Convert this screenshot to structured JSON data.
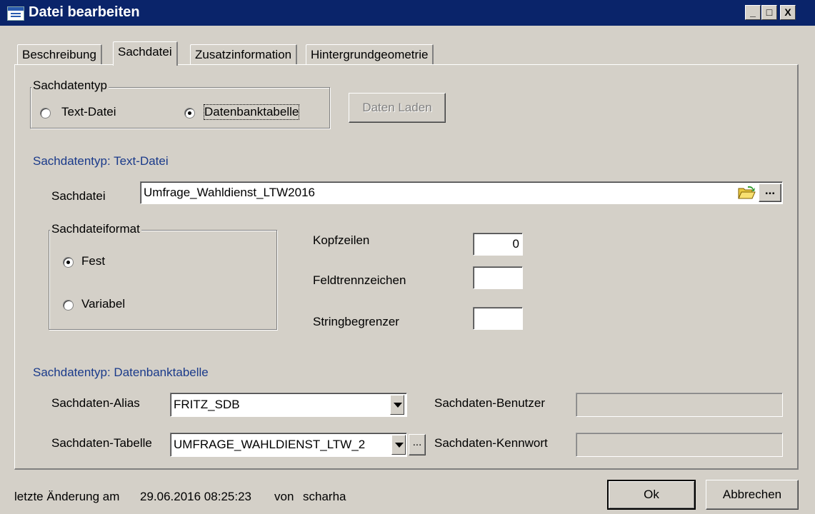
{
  "window": {
    "title": "Datei bearbeiten",
    "minimize": "_",
    "maximize": "□",
    "close": "X"
  },
  "tabs": [
    "Beschreibung",
    "Sachdatei",
    "Zusatzinformation",
    "Hintergrundgeometrie"
  ],
  "active_tab": "Sachdatei",
  "sachdatentyp": {
    "legend": "Sachdatentyp",
    "options": [
      "Text-Datei",
      "Datenbanktabelle"
    ],
    "selected": "Datenbanktabelle"
  },
  "daten_laden": "Daten Laden",
  "text_section": {
    "heading": "Sachdatentyp: Text-Datei",
    "sachdatei_label": "Sachdatei",
    "sachdatei_value": "Umfrage_Wahldienst_LTW2016",
    "browse_label": "...",
    "format": {
      "legend": "Sachdateiformat",
      "options": [
        "Fest",
        "Variabel"
      ],
      "selected": "Fest"
    },
    "kopfzeilen_label": "Kopfzeilen",
    "kopfzeilen_value": "0",
    "feldtrenn_label": "Feldtrennzeichen",
    "feldtrenn_value": "",
    "stringbeg_label": "Stringbegrenzer",
    "stringbeg_value": ""
  },
  "db_section": {
    "heading": "Sachdatentyp: Datenbanktabelle",
    "alias_label": "Sachdaten-Alias",
    "alias_value": "FRITZ_SDB",
    "benutzer_label": "Sachdaten-Benutzer",
    "benutzer_value": "",
    "tabelle_label": "Sachdaten-Tabelle",
    "tabelle_value": "UMFRAGE_WAHLDIENST_LTW_2",
    "tabelle_browse": "...",
    "kennwort_label": "Sachdaten-Kennwort",
    "kennwort_value": ""
  },
  "status": {
    "changed_label": "letzte Änderung am",
    "changed_date": "29.06.2016 08:25:23",
    "von_label": "von",
    "user": "scharha"
  },
  "ok": "Ok",
  "cancel": "Abbrechen"
}
